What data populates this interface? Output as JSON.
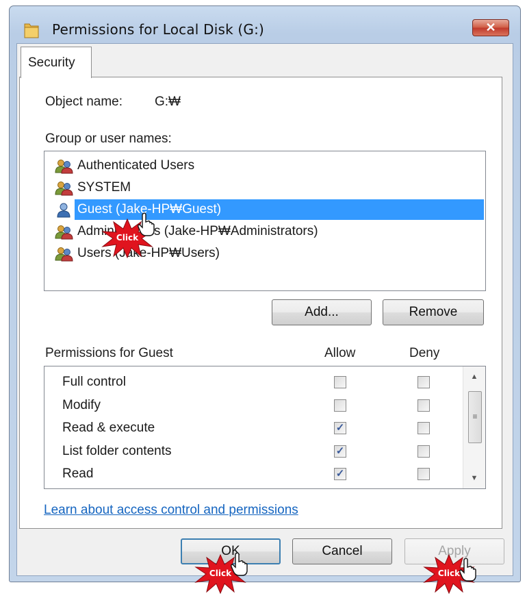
{
  "window": {
    "title": "Permissions for Local Disk (G:)",
    "close_label": "✕"
  },
  "tabs": [
    {
      "label": "Security"
    }
  ],
  "object": {
    "label": "Object name:",
    "value": "G:₩"
  },
  "users": {
    "label": "Group or user names:",
    "items": [
      {
        "name": "Authenticated Users",
        "icon": "group-icon",
        "selected": false
      },
      {
        "name": "SYSTEM",
        "icon": "group-icon",
        "selected": false
      },
      {
        "name": "Guest (Jake-HP₩Guest)",
        "icon": "user-icon",
        "selected": true
      },
      {
        "name": "Administrators (Jake-HP₩Administrators)",
        "icon": "group-icon",
        "selected": false
      },
      {
        "name": "Users (Jake-HP₩Users)",
        "icon": "group-icon",
        "selected": false
      }
    ]
  },
  "buttons": {
    "add": "Add...",
    "remove": "Remove",
    "ok": "OK",
    "cancel": "Cancel",
    "apply": "Apply"
  },
  "permissions": {
    "label": "Permissions for Guest",
    "allow_header": "Allow",
    "deny_header": "Deny",
    "items": [
      {
        "name": "Full control",
        "allow": false,
        "deny": false
      },
      {
        "name": "Modify",
        "allow": false,
        "deny": false
      },
      {
        "name": "Read & execute",
        "allow": true,
        "deny": false
      },
      {
        "name": "List folder contents",
        "allow": true,
        "deny": false
      },
      {
        "name": "Read",
        "allow": true,
        "deny": false
      }
    ]
  },
  "link": "Learn about access control and permissions",
  "annotations": {
    "click_label": "Click"
  },
  "colors": {
    "selection": "#3399ff",
    "link": "#1565c0",
    "burst": "#e0141e"
  }
}
